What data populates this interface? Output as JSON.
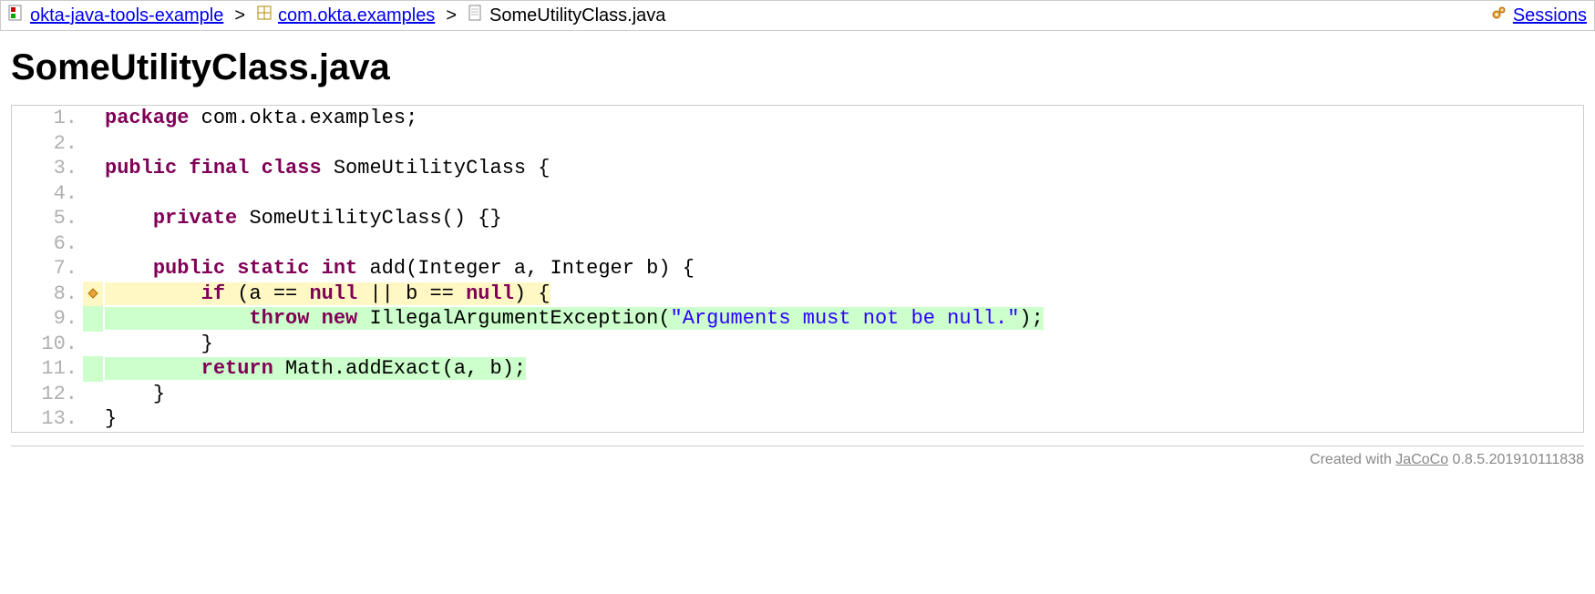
{
  "breadcrumb": {
    "items": [
      {
        "label": "okta-java-tools-example",
        "link": true,
        "icon": "report"
      },
      {
        "label": "com.okta.examples",
        "link": true,
        "icon": "package"
      },
      {
        "label": "SomeUtilityClass.java",
        "link": false,
        "icon": "file"
      }
    ],
    "separator": ">",
    "sessions_label": "Sessions"
  },
  "page_title": "SomeUtilityClass.java",
  "colors": {
    "partial_bg": "#fff8c5",
    "full_bg": "#ccffcc",
    "keyword": "#7f0055",
    "string": "#2a00ff"
  },
  "source": {
    "lines": [
      {
        "n": "1.",
        "cov": "none",
        "tokens": [
          [
            "kw",
            "package"
          ],
          [
            "sp",
            " "
          ],
          [
            "pkg",
            "com"
          ],
          [
            "punct",
            "."
          ],
          [
            "pkg",
            "okta"
          ],
          [
            "punct",
            "."
          ],
          [
            "pkg",
            "examples"
          ],
          [
            "punct",
            ";"
          ]
        ]
      },
      {
        "n": "2.",
        "cov": "none",
        "tokens": []
      },
      {
        "n": "3.",
        "cov": "none",
        "tokens": [
          [
            "kw",
            "public"
          ],
          [
            "sp",
            " "
          ],
          [
            "kw",
            "final"
          ],
          [
            "sp",
            " "
          ],
          [
            "kw",
            "class"
          ],
          [
            "sp",
            " "
          ],
          [
            "id",
            "SomeUtilityClass"
          ],
          [
            "sp",
            " "
          ],
          [
            "punct",
            "{"
          ]
        ]
      },
      {
        "n": "4.",
        "cov": "none",
        "tokens": []
      },
      {
        "n": "5.",
        "cov": "none",
        "tokens": [
          [
            "sp",
            "    "
          ],
          [
            "kw",
            "private"
          ],
          [
            "sp",
            " "
          ],
          [
            "id",
            "SomeUtilityClass"
          ],
          [
            "punct",
            "()"
          ],
          [
            "sp",
            " "
          ],
          [
            "punct",
            "{}"
          ]
        ]
      },
      {
        "n": "6.",
        "cov": "none",
        "tokens": []
      },
      {
        "n": "7.",
        "cov": "none",
        "tokens": [
          [
            "sp",
            "    "
          ],
          [
            "kw",
            "public"
          ],
          [
            "sp",
            " "
          ],
          [
            "kw",
            "static"
          ],
          [
            "sp",
            " "
          ],
          [
            "kw",
            "int"
          ],
          [
            "sp",
            " "
          ],
          [
            "id",
            "add"
          ],
          [
            "punct",
            "("
          ],
          [
            "id",
            "Integer"
          ],
          [
            "sp",
            " "
          ],
          [
            "id",
            "a"
          ],
          [
            "punct",
            ","
          ],
          [
            "sp",
            " "
          ],
          [
            "id",
            "Integer"
          ],
          [
            "sp",
            " "
          ],
          [
            "id",
            "b"
          ],
          [
            "punct",
            ")"
          ],
          [
            "sp",
            " "
          ],
          [
            "punct",
            "{"
          ]
        ]
      },
      {
        "n": "8.",
        "cov": "pc",
        "marker": "diamond",
        "tokens": [
          [
            "sp",
            "        "
          ],
          [
            "kw",
            "if"
          ],
          [
            "sp",
            " "
          ],
          [
            "punct",
            "("
          ],
          [
            "id",
            "a"
          ],
          [
            "sp",
            " "
          ],
          [
            "punct",
            "=="
          ],
          [
            "sp",
            " "
          ],
          [
            "kw",
            "null"
          ],
          [
            "sp",
            " "
          ],
          [
            "punct",
            "||"
          ],
          [
            "sp",
            " "
          ],
          [
            "id",
            "b"
          ],
          [
            "sp",
            " "
          ],
          [
            "punct",
            "=="
          ],
          [
            "sp",
            " "
          ],
          [
            "kw",
            "null"
          ],
          [
            "punct",
            ")"
          ],
          [
            "sp",
            " "
          ],
          [
            "punct",
            "{"
          ]
        ]
      },
      {
        "n": "9.",
        "cov": "fc",
        "tokens": [
          [
            "sp",
            "            "
          ],
          [
            "kw",
            "throw"
          ],
          [
            "sp",
            " "
          ],
          [
            "kw",
            "new"
          ],
          [
            "sp",
            " "
          ],
          [
            "id",
            "IllegalArgumentException"
          ],
          [
            "punct",
            "("
          ],
          [
            "str",
            "\"Arguments must not be null.\""
          ],
          [
            "punct",
            ")"
          ],
          [
            "punct",
            ";"
          ]
        ]
      },
      {
        "n": "10.",
        "cov": "none",
        "tokens": [
          [
            "sp",
            "        "
          ],
          [
            "punct",
            "}"
          ]
        ]
      },
      {
        "n": "11.",
        "cov": "fc",
        "tokens": [
          [
            "sp",
            "        "
          ],
          [
            "kw",
            "return"
          ],
          [
            "sp",
            " "
          ],
          [
            "id",
            "Math"
          ],
          [
            "punct",
            "."
          ],
          [
            "id",
            "addExact"
          ],
          [
            "punct",
            "("
          ],
          [
            "id",
            "a"
          ],
          [
            "punct",
            ","
          ],
          [
            "sp",
            " "
          ],
          [
            "id",
            "b"
          ],
          [
            "punct",
            ")"
          ],
          [
            "punct",
            ";"
          ]
        ]
      },
      {
        "n": "12.",
        "cov": "none",
        "tokens": [
          [
            "sp",
            "    "
          ],
          [
            "punct",
            "}"
          ]
        ]
      },
      {
        "n": "13.",
        "cov": "none",
        "tokens": [
          [
            "punct",
            "}"
          ]
        ]
      }
    ]
  },
  "footer": {
    "prefix": "Created with ",
    "link_text": "JaCoCo",
    "version": " 0.8.5.201910111838"
  }
}
